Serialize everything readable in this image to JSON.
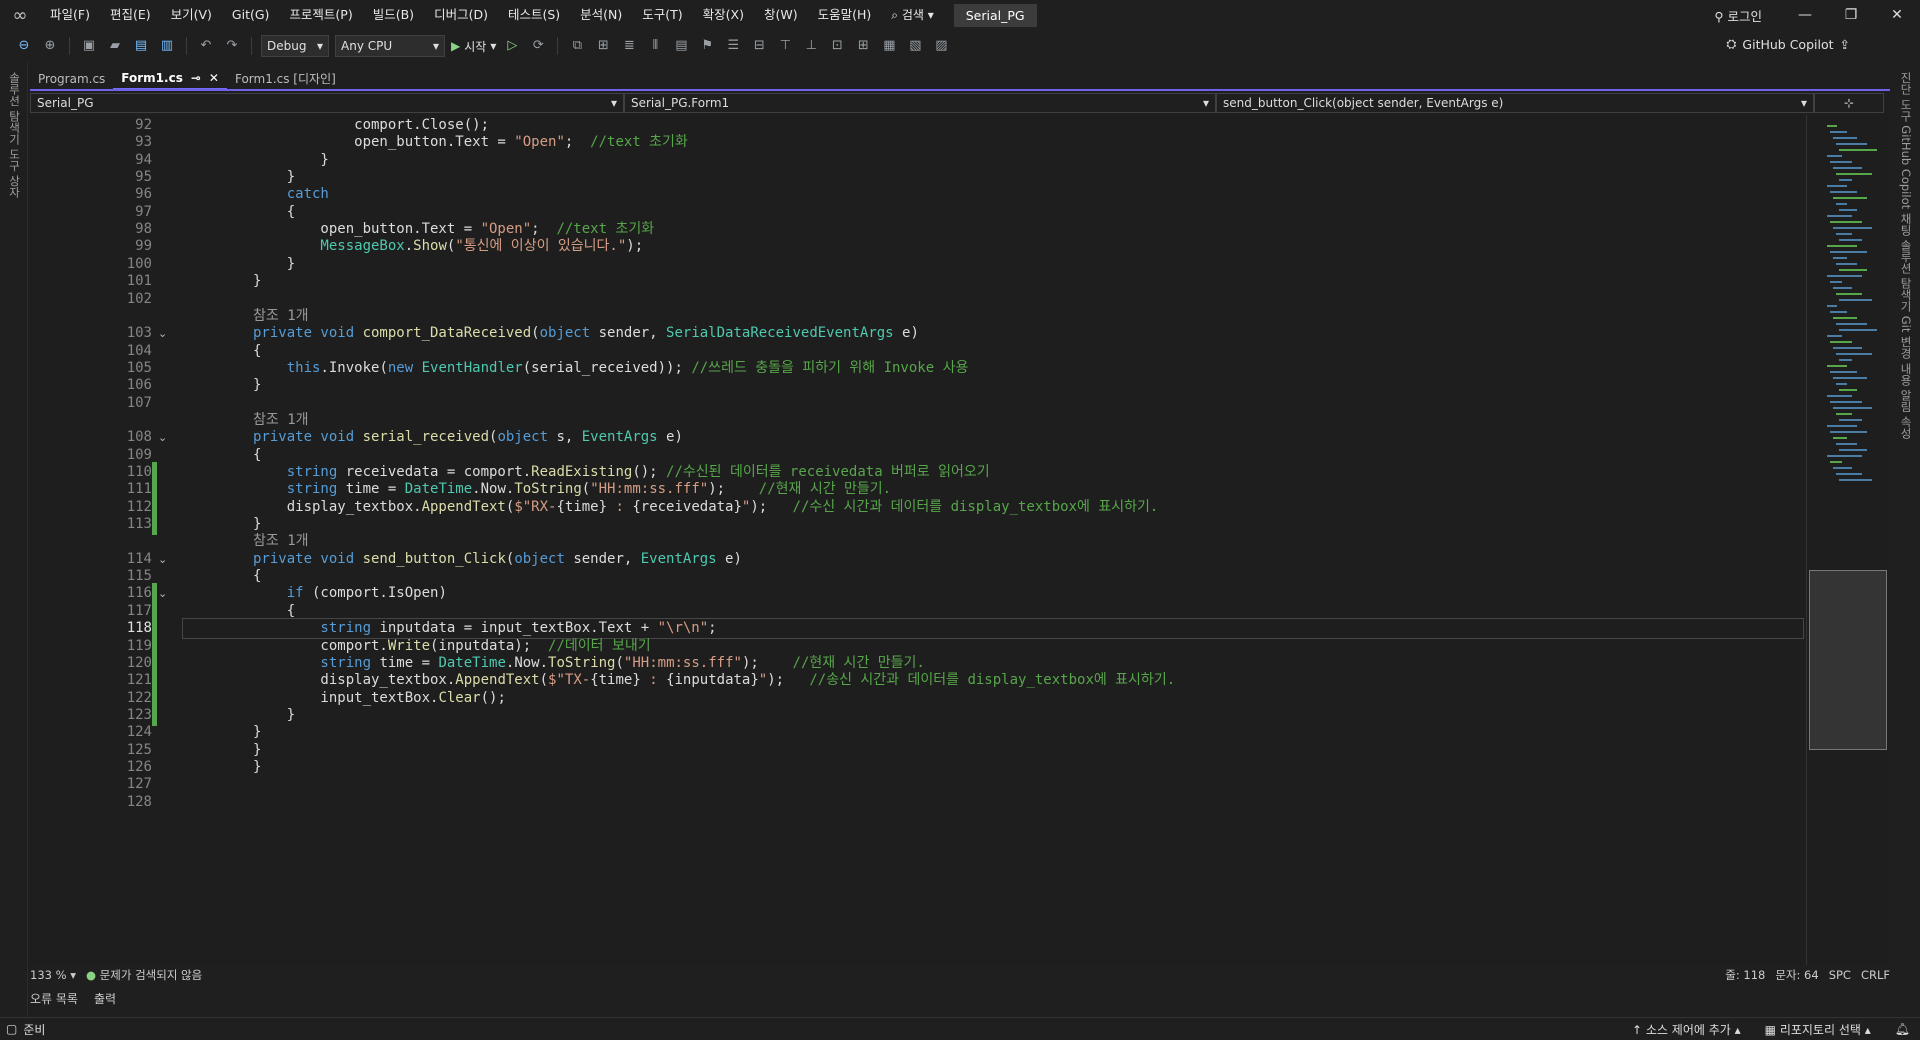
{
  "menubar": {
    "items": [
      "파일(F)",
      "편집(E)",
      "보기(V)",
      "Git(G)",
      "프로젝트(P)",
      "빌드(B)",
      "디버그(D)",
      "테스트(S)",
      "분석(N)",
      "도구(T)",
      "확장(X)",
      "창(W)",
      "도움말(H)"
    ],
    "search_label": "검색",
    "solution_name": "Serial_PG",
    "login_label": "로그인"
  },
  "toolbar": {
    "config": "Debug",
    "platform": "Any CPU",
    "start_label": "시작",
    "copilot_label": "GitHub Copilot"
  },
  "tabs": [
    {
      "label": "Program.cs",
      "active": false
    },
    {
      "label": "Form1.cs",
      "active": true
    },
    {
      "label": "Form1.cs [디자인]",
      "active": false
    }
  ],
  "navbar": {
    "project": "Serial_PG",
    "class": "Serial_PG.Form1",
    "member": "send_button_Click(object sender, EventArgs e)"
  },
  "left_strip": {
    "label": "솔루션 탐색기  도구 상자"
  },
  "right_strip": {
    "label": "진단 도구  GitHub Copilot 채팅  솔루션 탐색기  Git 변경 내용  알림  속성"
  },
  "editor": {
    "current_line": 118,
    "lines": [
      {
        "n": "92",
        "t": [
          [
            "",
            "            comport.Close();"
          ]
        ]
      },
      {
        "n": "93",
        "t": [
          [
            "",
            "            open_button.Text = "
          ],
          [
            "st",
            "\"Open\""
          ],
          [
            "",
            ";  "
          ],
          [
            "cm",
            "//text 초기화"
          ]
        ]
      },
      {
        "n": "94",
        "t": [
          [
            "",
            "        }"
          ]
        ]
      },
      {
        "n": "95",
        "t": [
          [
            "",
            "    }"
          ]
        ]
      },
      {
        "n": "96",
        "t": [
          [
            "kw",
            "    catch"
          ]
        ]
      },
      {
        "n": "97",
        "t": [
          [
            "",
            "    {"
          ]
        ]
      },
      {
        "n": "98",
        "t": [
          [
            "",
            "        open_button.Text = "
          ],
          [
            "st",
            "\"Open\""
          ],
          [
            "",
            ";  "
          ],
          [
            "cm",
            "//text 초기화"
          ]
        ]
      },
      {
        "n": "99",
        "t": [
          [
            "ty",
            "        MessageBox"
          ],
          [
            "",
            "."
          ],
          [
            "mt",
            "Show"
          ],
          [
            "",
            "("
          ],
          [
            "st",
            "\"통신에 이상이 있습니다.\""
          ],
          [
            "",
            ");"
          ]
        ]
      },
      {
        "n": "100",
        "t": [
          [
            "",
            "    }"
          ]
        ]
      },
      {
        "n": "101",
        "t": [
          [
            "",
            "}"
          ]
        ]
      },
      {
        "n": "102",
        "t": [
          [
            "",
            ""
          ]
        ]
      },
      {
        "lens": "참조 1개"
      },
      {
        "n": "103",
        "fold": true,
        "t": [
          [
            "kw",
            "private void "
          ],
          [
            "mt",
            "comport_DataReceived"
          ],
          [
            "",
            "("
          ],
          [
            "kw",
            "object"
          ],
          [
            "",
            " sender, "
          ],
          [
            "ty",
            "SerialDataReceivedEventArgs"
          ],
          [
            "",
            " e)"
          ]
        ]
      },
      {
        "n": "104",
        "t": [
          [
            "",
            "{"
          ]
        ]
      },
      {
        "n": "105",
        "t": [
          [
            "kw",
            "    this"
          ],
          [
            "",
            ".Invoke("
          ],
          [
            "kw",
            "new "
          ],
          [
            "ty",
            "EventHandler"
          ],
          [
            "",
            "(serial_received)); "
          ],
          [
            "cm",
            "//쓰레드 충돌을 피하기 위해 Invoke 사용"
          ]
        ]
      },
      {
        "n": "106",
        "t": [
          [
            "",
            "}"
          ]
        ]
      },
      {
        "n": "107",
        "t": [
          [
            "",
            ""
          ]
        ]
      },
      {
        "lens": "참조 1개"
      },
      {
        "n": "108",
        "fold": true,
        "t": [
          [
            "kw",
            "private void "
          ],
          [
            "mt",
            "serial_received"
          ],
          [
            "",
            "("
          ],
          [
            "kw",
            "object"
          ],
          [
            "",
            " s, "
          ],
          [
            "ty",
            "EventArgs"
          ],
          [
            "",
            " e)"
          ]
        ]
      },
      {
        "n": "109",
        "t": [
          [
            "",
            "{"
          ]
        ]
      },
      {
        "n": "110",
        "chg": true,
        "t": [
          [
            "kw",
            "    string "
          ],
          [
            "",
            "receivedata = comport."
          ],
          [
            "mt",
            "ReadExisting"
          ],
          [
            "",
            "(); "
          ],
          [
            "cm",
            "//수신된 데이터를 receivedata 버퍼로 읽어오기"
          ]
        ]
      },
      {
        "n": "111",
        "chg": true,
        "t": [
          [
            "kw",
            "    string "
          ],
          [
            "",
            "time = "
          ],
          [
            "ty",
            "DateTime"
          ],
          [
            "",
            ".Now."
          ],
          [
            "mt",
            "ToString"
          ],
          [
            "",
            "("
          ],
          [
            "st",
            "\"HH:mm:ss.fff\""
          ],
          [
            "",
            ");    "
          ],
          [
            "cm",
            "//현재 시간 만들기."
          ]
        ]
      },
      {
        "n": "112",
        "chg": true,
        "t": [
          [
            "",
            "    display_textbox."
          ],
          [
            "mt",
            "AppendText"
          ],
          [
            "",
            "("
          ],
          [
            "st",
            "$\"RX-"
          ],
          [
            "",
            "{time}"
          ],
          [
            "st",
            " : "
          ],
          [
            "",
            "{receivedata}"
          ],
          [
            "st",
            "\""
          ],
          [
            "",
            ");   "
          ],
          [
            "cm",
            "//수신 시간과 데이터를 display_textbox에 표시하기."
          ]
        ]
      },
      {
        "n": "113",
        "chg": true,
        "t": [
          [
            "",
            "}"
          ]
        ]
      },
      {
        "lens": "참조 1개"
      },
      {
        "n": "114",
        "fold": true,
        "t": [
          [
            "kw",
            "private void "
          ],
          [
            "mt",
            "send_button_Click"
          ],
          [
            "",
            "("
          ],
          [
            "kw",
            "object"
          ],
          [
            "",
            " sender, "
          ],
          [
            "ty",
            "EventArgs"
          ],
          [
            "",
            " e)"
          ]
        ]
      },
      {
        "n": "115",
        "t": [
          [
            "",
            "{"
          ]
        ]
      },
      {
        "n": "116",
        "fold": true,
        "chg": true,
        "t": [
          [
            "kw",
            "    if"
          ],
          [
            "",
            " (comport.IsOpen)"
          ]
        ]
      },
      {
        "n": "117",
        "chg": true,
        "t": [
          [
            "",
            "    {"
          ]
        ]
      },
      {
        "n": "118",
        "chg": true,
        "cur": true,
        "t": [
          [
            "kw",
            "        string "
          ],
          [
            "",
            "inputdata = input_textBox.Text + "
          ],
          [
            "st",
            "\"\\r\\n\""
          ],
          [
            "",
            ";"
          ]
        ]
      },
      {
        "n": "119",
        "chg": true,
        "t": [
          [
            "",
            "        comport."
          ],
          [
            "mt",
            "Write"
          ],
          [
            "",
            "(inputdata);  "
          ],
          [
            "cm",
            "//데이터 보내기"
          ]
        ]
      },
      {
        "n": "120",
        "chg": true,
        "t": [
          [
            "kw",
            "        string "
          ],
          [
            "",
            "time = "
          ],
          [
            "ty",
            "DateTime"
          ],
          [
            "",
            ".Now."
          ],
          [
            "mt",
            "ToString"
          ],
          [
            "",
            "("
          ],
          [
            "st",
            "\"HH:mm:ss.fff\""
          ],
          [
            "",
            ");    "
          ],
          [
            "cm",
            "//현재 시간 만들기."
          ]
        ]
      },
      {
        "n": "121",
        "chg": true,
        "t": [
          [
            "",
            "        display_textbox."
          ],
          [
            "mt",
            "AppendText"
          ],
          [
            "",
            "("
          ],
          [
            "st",
            "$\"TX-"
          ],
          [
            "",
            "{time}"
          ],
          [
            "st",
            " : "
          ],
          [
            "",
            "{inputdata}"
          ],
          [
            "st",
            "\""
          ],
          [
            "",
            ");   "
          ],
          [
            "cm",
            "//송신 시간과 데이터를 display_textbox에 표시하기."
          ]
        ]
      },
      {
        "n": "122",
        "chg": true,
        "t": [
          [
            "",
            "        input_textBox."
          ],
          [
            "mt",
            "Clear"
          ],
          [
            "",
            "();"
          ]
        ]
      },
      {
        "n": "123",
        "chg": true,
        "t": [
          [
            "",
            "    }"
          ]
        ]
      },
      {
        "n": "124",
        "t": [
          [
            "",
            "}"
          ]
        ]
      },
      {
        "n": "125",
        "t": [
          [
            "",
            "}"
          ]
        ]
      },
      {
        "n": "126",
        "t": [
          [
            "",
            "}"
          ]
        ]
      },
      {
        "n": "127",
        "t": [
          [
            "",
            ""
          ]
        ]
      },
      {
        "n": "128",
        "t": [
          [
            "",
            ""
          ]
        ]
      }
    ]
  },
  "status_row": {
    "zoom": "133 %",
    "issues": "문제가 검색되지 않음",
    "line": "줄: 118",
    "col": "문자: 64",
    "spc": "SPC",
    "eol": "CRLF"
  },
  "panel_tabs": [
    "오류 목록",
    "출력"
  ],
  "statusbar": {
    "ready": "준비",
    "source_control": "소스 제어에 추가",
    "repo": "리포지토리 선택"
  }
}
